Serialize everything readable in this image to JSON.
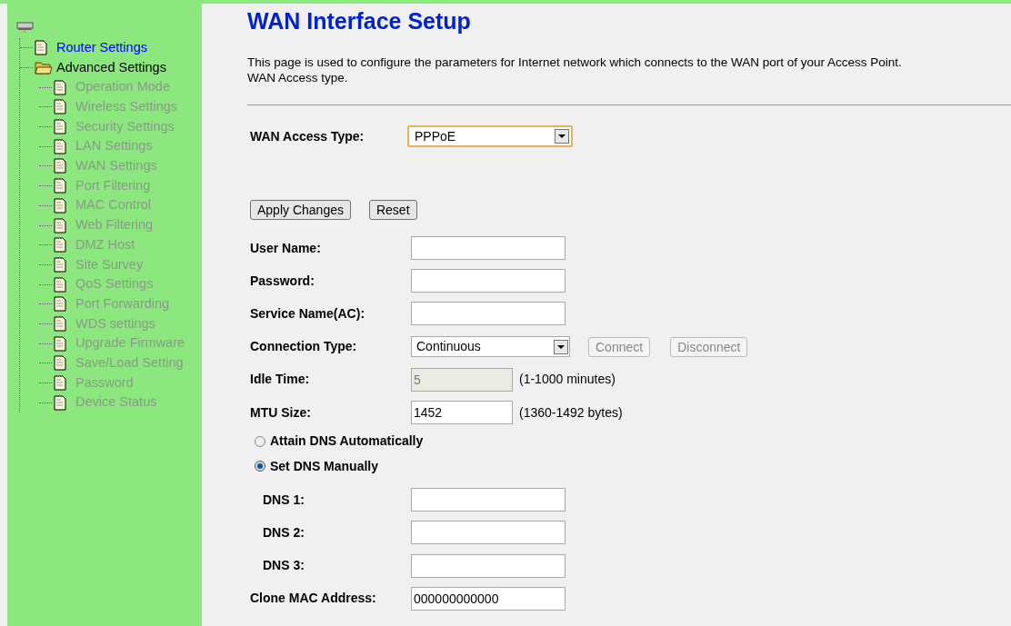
{
  "tree": {
    "children": [
      {
        "label": "Router Settings",
        "kind": "page",
        "selected": true,
        "disabled": false
      },
      {
        "label": "Advanced Settings",
        "kind": "folder",
        "selected": false,
        "disabled": false,
        "expanded": true,
        "children": [
          {
            "label": "Operation Mode",
            "kind": "page",
            "selected": false,
            "disabled": true
          },
          {
            "label": "Wireless Settings",
            "kind": "page",
            "selected": false,
            "disabled": true
          },
          {
            "label": "Security Settings",
            "kind": "page",
            "selected": false,
            "disabled": true
          },
          {
            "label": "LAN Settings",
            "kind": "page",
            "selected": false,
            "disabled": true
          },
          {
            "label": "WAN Settings",
            "kind": "page",
            "selected": false,
            "disabled": true
          },
          {
            "label": "Port Filtering",
            "kind": "page",
            "selected": false,
            "disabled": true
          },
          {
            "label": "MAC Control",
            "kind": "page",
            "selected": false,
            "disabled": true
          },
          {
            "label": "Web Filtering",
            "kind": "page",
            "selected": false,
            "disabled": true
          },
          {
            "label": "DMZ Host",
            "kind": "page",
            "selected": false,
            "disabled": true
          },
          {
            "label": "Site Survey",
            "kind": "page",
            "selected": false,
            "disabled": true
          },
          {
            "label": "QoS Settings",
            "kind": "page",
            "selected": false,
            "disabled": true
          },
          {
            "label": "Port Forwarding",
            "kind": "page",
            "selected": false,
            "disabled": true
          },
          {
            "label": "WDS settings",
            "kind": "page",
            "selected": false,
            "disabled": true
          },
          {
            "label": "Upgrade Firmware",
            "kind": "page",
            "selected": false,
            "disabled": true
          },
          {
            "label": "Save/Load Setting",
            "kind": "page",
            "selected": false,
            "disabled": true
          },
          {
            "label": "Password",
            "kind": "page",
            "selected": false,
            "disabled": true
          },
          {
            "label": "Device Status",
            "kind": "page",
            "selected": false,
            "disabled": true
          }
        ]
      }
    ]
  },
  "title": "WAN Interface Setup",
  "description": [
    "This page is used to configure the parameters for Internet network which connects to the WAN port of your Access Point.",
    "WAN Access type."
  ],
  "access_type": {
    "label": "WAN Access Type:",
    "value": "PPPoE"
  },
  "buttons": [
    {
      "label": "Apply Changes",
      "disabled": false
    },
    {
      "label": "Reset",
      "disabled": false
    }
  ],
  "rows": [
    {
      "kind": "text",
      "label": "User Name:",
      "disabled": false
    },
    {
      "kind": "text",
      "label": "Password:",
      "disabled": false
    },
    {
      "kind": "text",
      "label": "Service Name(AC):",
      "disabled": false
    },
    {
      "kind": "select",
      "label": "Connection Type:",
      "value": "Continuous",
      "buttons": [
        {
          "label": "Connect",
          "disabled": true
        },
        {
          "label": "Disconnect",
          "disabled": true
        }
      ]
    },
    {
      "kind": "text",
      "label": "Idle Time:",
      "value": "5",
      "hint": "(1-1000 minutes)",
      "disabled": true
    },
    {
      "kind": "text",
      "label": "MTU Size:",
      "value": "1452",
      "hint": "(1360-1492 bytes)",
      "disabled": false
    },
    {
      "kind": "radio",
      "label": "Attain DNS Automatically",
      "selected": false
    },
    {
      "kind": "radio",
      "label": "Set DNS Manually",
      "selected": true,
      "children": [
        {
          "kind": "text",
          "label": "DNS 1:",
          "disabled": false
        },
        {
          "kind": "text",
          "label": "DNS 2:",
          "disabled": false
        },
        {
          "kind": "text",
          "label": "DNS 3:",
          "disabled": false
        }
      ]
    },
    {
      "kind": "text",
      "label": "Clone MAC Address:",
      "value": "000000000000",
      "disabled": false
    }
  ]
}
